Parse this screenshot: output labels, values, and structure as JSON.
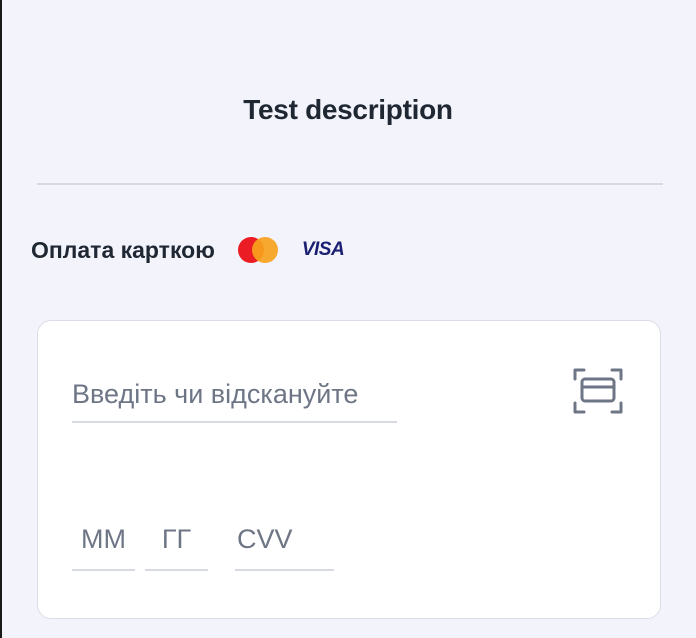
{
  "header": {
    "title": "Test description"
  },
  "payment": {
    "label": "Оплата карткою",
    "brands": [
      "mastercard-logo",
      "visa-logo"
    ],
    "visa_text": "VISA"
  },
  "card_form": {
    "card_number_placeholder": "Введіть чи відскануйте",
    "scan_icon": "card-scan-icon",
    "month_placeholder": "ММ",
    "year_placeholder": "ГГ",
    "cvv_placeholder": "CVV"
  },
  "colors": {
    "background": "#f3f3fc",
    "title_text": "#1f2733",
    "placeholder_text": "#6e7686",
    "mastercard_red": "#eb1c24",
    "mastercard_yellow": "#f7a21c",
    "visa_blue": "#1a1f71"
  }
}
